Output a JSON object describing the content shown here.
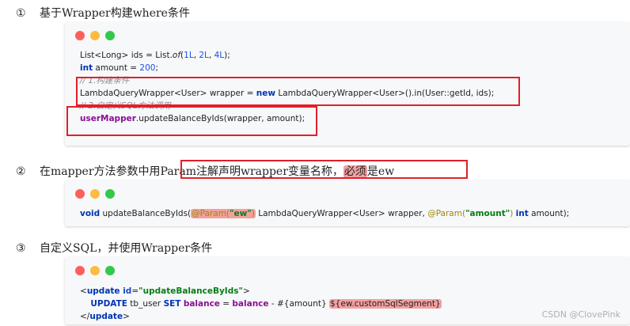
{
  "steps": [
    {
      "num": "①",
      "text": "基于Wrapper构建where条件"
    },
    {
      "num": "②",
      "text_before": "在mapper方法参数中用",
      "text_boxed_a": "Param注解声明wrapper变量名称，",
      "text_boxed_hl": "必须",
      "text_boxed_b": "是ew"
    },
    {
      "num": "③",
      "text": "自定义SQL，并使用Wrapper条件"
    }
  ],
  "block1": {
    "l1_a": "List<Long> ids = List.",
    "l1_of": "of",
    "l1_b": "(",
    "l1_n1": "1L",
    "l1_c1": ", ",
    "l1_n2": "2L",
    "l1_c2": ", ",
    "l1_n3": "4L",
    "l1_e": ");",
    "l2_kw": "int",
    "l2_a": " amount = ",
    "l2_n": "200",
    "l2_e": ";",
    "l3": "// 1.构建条件",
    "l4_a": "LambdaQueryWrapper<User> wrapper = ",
    "l4_kw": "new",
    "l4_b": " LambdaQueryWrapper<User>().in(User::getId, ids);",
    "l5": "// 2.自定义SQL方法调用",
    "l6_f": "userMapper",
    "l6_b": ".updateBalanceByIds(wrapper, amount);"
  },
  "block2": {
    "kw_void": "void",
    "a": " updateBalanceByIds(",
    "ann1": "@Param(",
    "str1": "\"ew\"",
    "ann1_close": ")",
    "b": " LambdaQueryWrapper<User> wrapper, ",
    "ann2": "@Param(",
    "str2": "\"amount\"",
    "ann2_close": ")",
    "c": " ",
    "kw_int": "int",
    "d": " amount);"
  },
  "block3": {
    "l1_open": "<",
    "l1_tag": "update",
    "l1_attr": " id",
    "l1_eq": "=",
    "l1_val": "\"updateBalanceByIds\"",
    "l1_close": ">",
    "l2_indent": "    ",
    "l2_kw1": "UPDATE",
    "l2_a": " tb_user ",
    "l2_kw2": "SET",
    "l2_b": " ",
    "l2_f1": "balance",
    "l2_c": " = ",
    "l2_f2": "balance",
    "l2_d": " - #{amount} ",
    "l2_hl": "${ew.customSqlSegment}",
    "l3_open": "</",
    "l3_tag": "update",
    "l3_close": ">"
  },
  "watermark": "CSDN @ClovePink",
  "colors": {
    "accent_red": "#e0202a",
    "highlight": "#f3a0a0",
    "keyword": "#0033b3",
    "string": "#067d17"
  }
}
